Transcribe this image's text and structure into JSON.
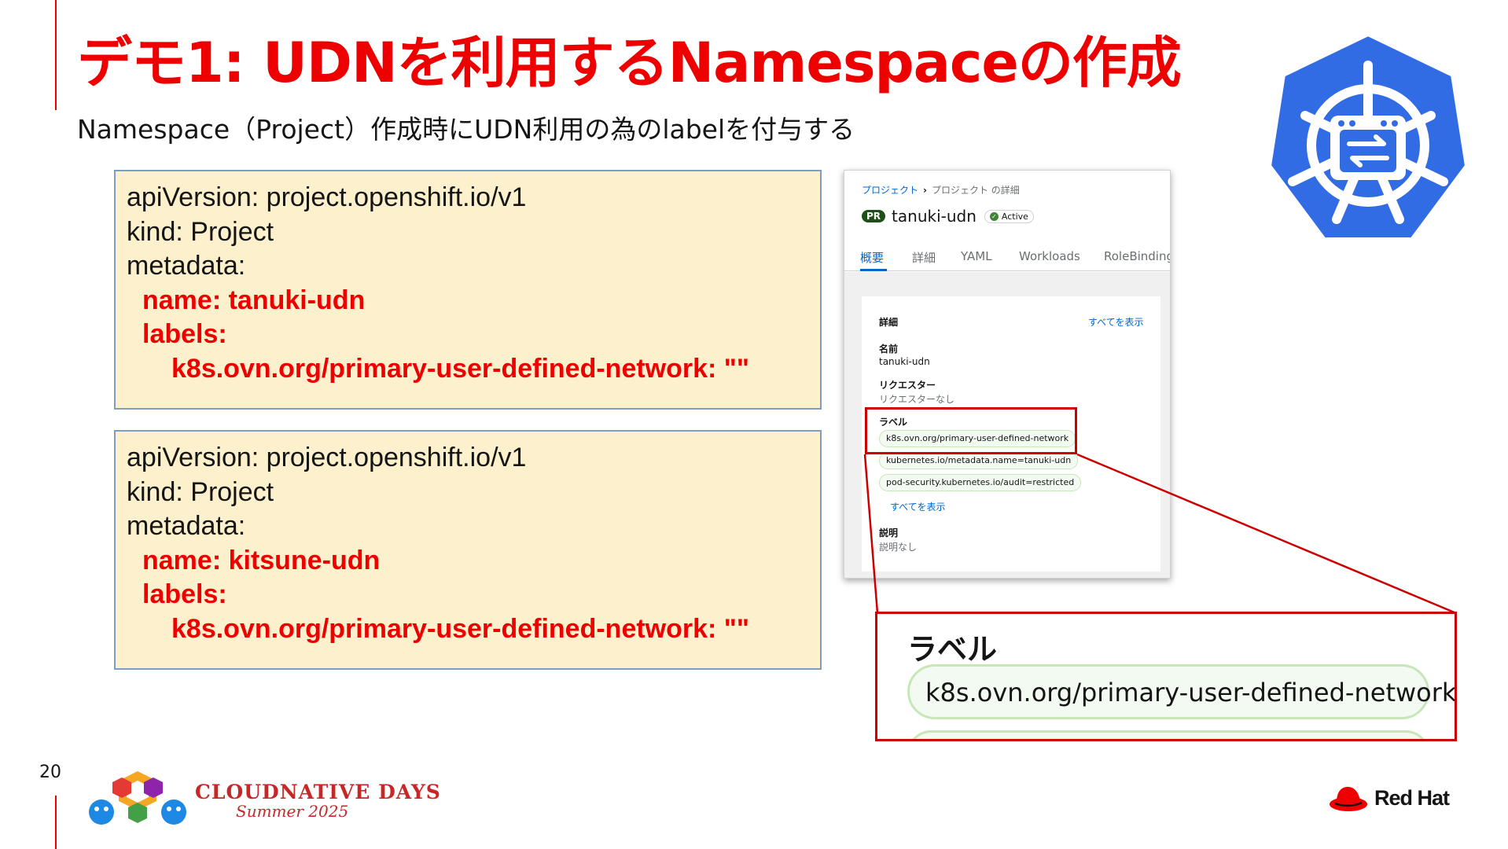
{
  "slide": {
    "title": "デモ1: UDNを利用するNamespaceの作成",
    "subtitle": "Namespace（Project）作成時にUDN利用の為のlabelを付与する",
    "page_number": "20"
  },
  "code_blocks": [
    {
      "api_version": "apiVersion: project.openshift.io/v1",
      "kind": "kind: Project",
      "metadata": "metadata:",
      "name": "name: tanuki-udn",
      "labels": "labels:",
      "label": "k8s.ovn.org/primary-user-defined-network: \"\""
    },
    {
      "api_version": "apiVersion: project.openshift.io/v1",
      "kind": "kind: Project",
      "metadata": "metadata:",
      "name": "name: kitsune-udn",
      "labels": "labels:",
      "label": "k8s.ovn.org/primary-user-defined-network: \"\""
    }
  ],
  "console": {
    "breadcrumb_link": "プロジェクト",
    "breadcrumb_sep": "›",
    "breadcrumb_current": "プロジェクト の詳細",
    "badge": "PR",
    "project_name": "tanuki-udn",
    "status": "Active",
    "tabs": [
      "概要",
      "詳細",
      "YAML",
      "Workloads",
      "RoleBindings"
    ],
    "section_title": "詳細",
    "show_all": "すべてを表示",
    "name_label": "名前",
    "name_value": "tanuki-udn",
    "requester_label": "リクエスター",
    "requester_value": "リクエスターなし",
    "labels_label": "ラベル",
    "labels": [
      "k8s.ovn.org/primary-user-defined-network",
      "kubernetes.io/metadata.name=tanuki-udn",
      "pod-security.kubernetes.io/audit=restricted"
    ],
    "labels_show_all": "すべてを表示",
    "description_label": "説明",
    "description_value": "説明なし"
  },
  "zoom": {
    "label": "ラベル",
    "chip": "k8s.ovn.org/primary-user-defined-network"
  },
  "footer": {
    "event_name": "CLOUDNATIVE DAYS",
    "event_sub": "Summer 2025",
    "brand": "Red Hat"
  },
  "colors": {
    "accent": "#ee0000",
    "code_bg": "#fdf0cc",
    "k8s_blue": "#326ce5",
    "link": "#0066cc"
  }
}
